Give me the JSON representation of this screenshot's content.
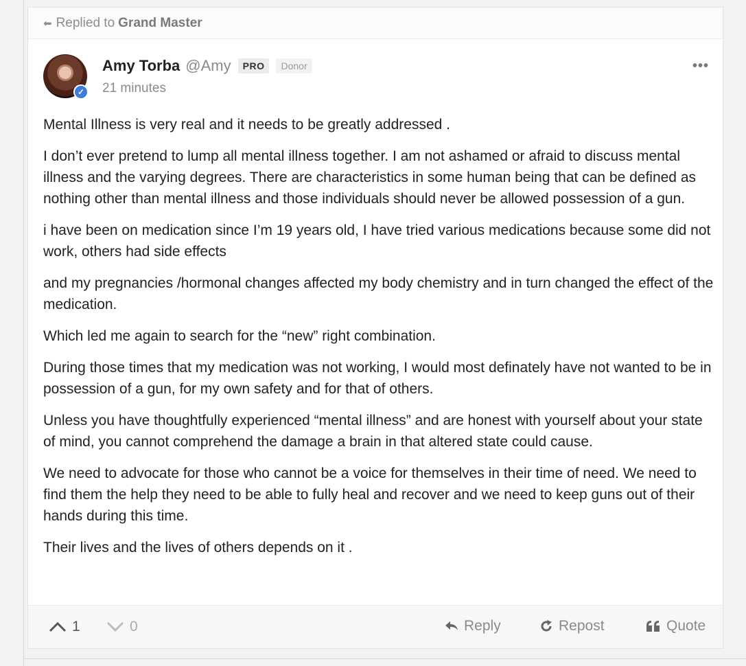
{
  "reply_bar": {
    "prefix": "Replied to",
    "user": "Grand Master"
  },
  "post": {
    "author_name": "Amy Torba",
    "author_handle": "@Amy",
    "badges": [
      "PRO",
      "Donor"
    ],
    "timestamp": "21 minutes",
    "more_menu": "•••",
    "paragraphs": [
      "Mental Illness is very real and it needs to be greatly addressed .",
      "I don’t ever pretend to lump all mental illness together. I am not ashamed or afraid to discuss mental illness and the varying degrees. There are characteristics in some human being that can be defined as nothing other than mental illness and those individuals should never be allowed possession of a gun.",
      "i have been on medication since I’m 19 years old, I have tried various medications because some did not work, others had side effects",
      "and my pregnancies /hormonal changes affected my body chemistry and in turn changed the effect of the medication.",
      "Which led me again to search for the “new” right combination.",
      "During those times that my medication was not working, I would most definately have not wanted to be in possession of a gun, for my own safety and for that of others.",
      "Unless you have thoughtfully experienced “mental illness” and are honest with yourself about your state of mind, you cannot comprehend the damage a brain in that altered state could cause.",
      "We need to advocate for those who cannot be a voice for themselves in their time of need. We need to find them the help they need to be able to fully heal and recover and we need to keep guns out of their hands during this time.",
      "Their lives and the lives of others depends on it ."
    ]
  },
  "actions": {
    "upvote_count": "1",
    "downvote_count": "0",
    "reply_label": "Reply",
    "repost_label": "Repost",
    "quote_label": "Quote"
  },
  "icons": {
    "reply_arrow": "reply-arrow-icon",
    "upvote": "chevron-up-icon",
    "downvote": "chevron-down-icon",
    "repost": "repost-icon",
    "quote": "quote-icon",
    "verified": "verified-check-icon"
  },
  "colors": {
    "verified_badge": "#3b7ddd",
    "muted_text": "#8a8a8a"
  }
}
